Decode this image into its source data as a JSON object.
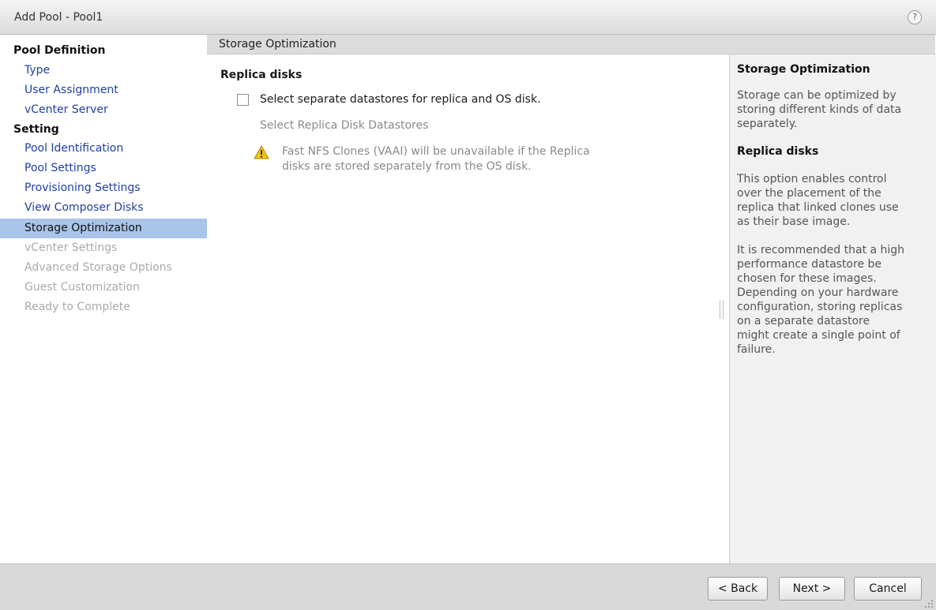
{
  "window": {
    "title": "Add Pool - Pool1",
    "help_glyph": "?"
  },
  "nav": {
    "sections": [
      {
        "label": "Pool Definition"
      },
      {
        "label": "Setting"
      }
    ],
    "items": [
      {
        "label": "Type",
        "state": "link"
      },
      {
        "label": "User Assignment",
        "state": "link"
      },
      {
        "label": "vCenter Server",
        "state": "link"
      },
      {
        "label": "Pool Identification",
        "state": "link"
      },
      {
        "label": "Pool Settings",
        "state": "link"
      },
      {
        "label": "Provisioning Settings",
        "state": "link"
      },
      {
        "label": "View Composer Disks",
        "state": "link"
      },
      {
        "label": "Storage Optimization",
        "state": "selected"
      },
      {
        "label": "vCenter Settings",
        "state": "disabled"
      },
      {
        "label": "Advanced Storage Options",
        "state": "disabled"
      },
      {
        "label": "Guest Customization",
        "state": "disabled"
      },
      {
        "label": "Ready to Complete",
        "state": "disabled"
      }
    ]
  },
  "main": {
    "header": "Storage Optimization",
    "section_title": "Replica disks",
    "checkbox_label": "Select separate datastores for replica and OS disk.",
    "checkbox_checked": false,
    "subsection_label": "Select Replica Disk Datastores",
    "warning_line1": "Fast NFS Clones (VAAI) will be unavailable if the Replica",
    "warning_line2": "disks are stored separately from the OS disk."
  },
  "help_panel": {
    "title": "Storage Optimization",
    "intro_lines": [
      "Storage can be optimized by",
      "storing different kinds of data",
      "separately."
    ],
    "subtitle": "Replica disks",
    "para1_lines": [
      "This option enables control",
      "over the placement of the",
      "replica that linked clones use",
      "as their base image."
    ],
    "para2_lines": [
      "It is recommended that a high",
      "performance datastore be",
      "chosen for these images.",
      "Depending on your hardware",
      "configuration, storing replicas",
      "on a separate datastore",
      "might create a single point of",
      "failure."
    ]
  },
  "footer": {
    "back_label": "< Back",
    "next_label": "Next >",
    "cancel_label": "Cancel"
  },
  "colors": {
    "link": "#1f3fa3",
    "disabled": "#aaaaaa",
    "selected_bg": "#a9c4e8",
    "warning_yellow": "#f2c21b"
  },
  "icons": {
    "help": "help-icon",
    "warning": "warning-icon",
    "resize_grip": "resize-grip-icon"
  }
}
